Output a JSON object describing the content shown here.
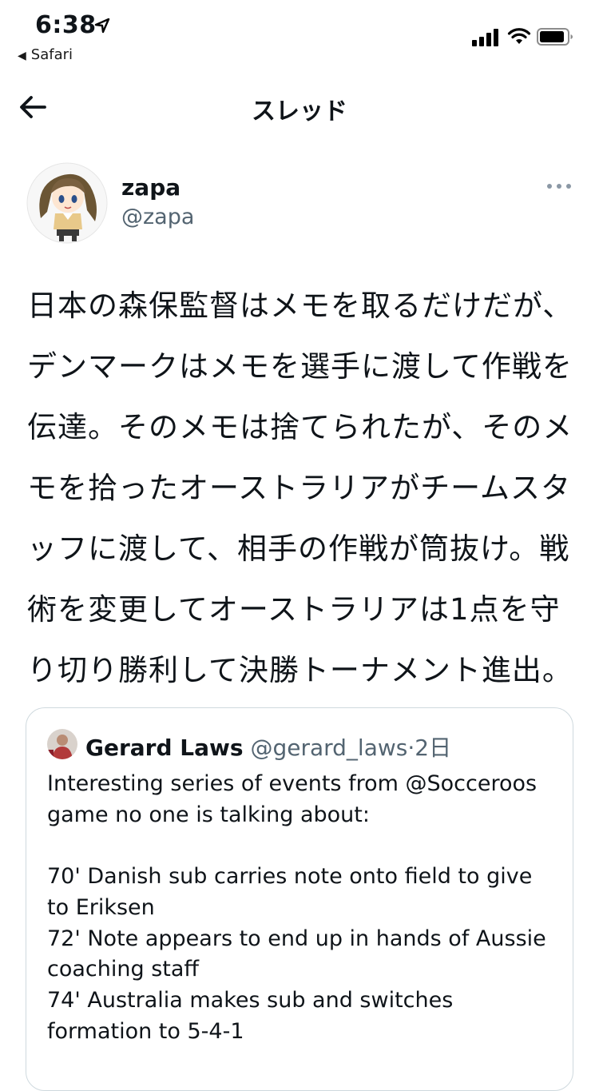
{
  "status_bar": {
    "time": "6:38",
    "back_app": "Safari"
  },
  "nav": {
    "title": "スレッド"
  },
  "tweet": {
    "display_name": "zapa",
    "handle": "@zapa",
    "text": "日本の森保監督はメモを取るだけだが、デンマークはメモを選手に渡して作戦を伝達。そのメモは捨てられたが、そのメモを拾ったオーストラリアがチームスタッフに渡して、相手の作戦が筒抜け。戦術を変更してオーストラリアは1点を守り切り勝利して決勝トーナメント進出。"
  },
  "quote": {
    "display_name": "Gerard Laws",
    "handle": "@gerard_laws",
    "separator": "·",
    "time": "2日",
    "lines": [
      "Interesting series of events from @Socceroos",
      "game no one is talking about:",
      "",
      "70' Danish sub carries note onto field to give",
      "to Eriksen",
      "72' Note appears to end up in hands of Aussie",
      "coaching staff",
      "74' Australia makes sub and switches",
      "formation to 5-4-1"
    ]
  },
  "icons": {
    "back": "back-arrow-icon",
    "more": "more-dots-icon",
    "location": "location-arrow-icon",
    "signal": "signal-icon",
    "wifi": "wifi-icon",
    "battery": "battery-icon"
  },
  "colors": {
    "text": "#0f1419",
    "secondary": "#536471",
    "border": "#cfd9de"
  }
}
